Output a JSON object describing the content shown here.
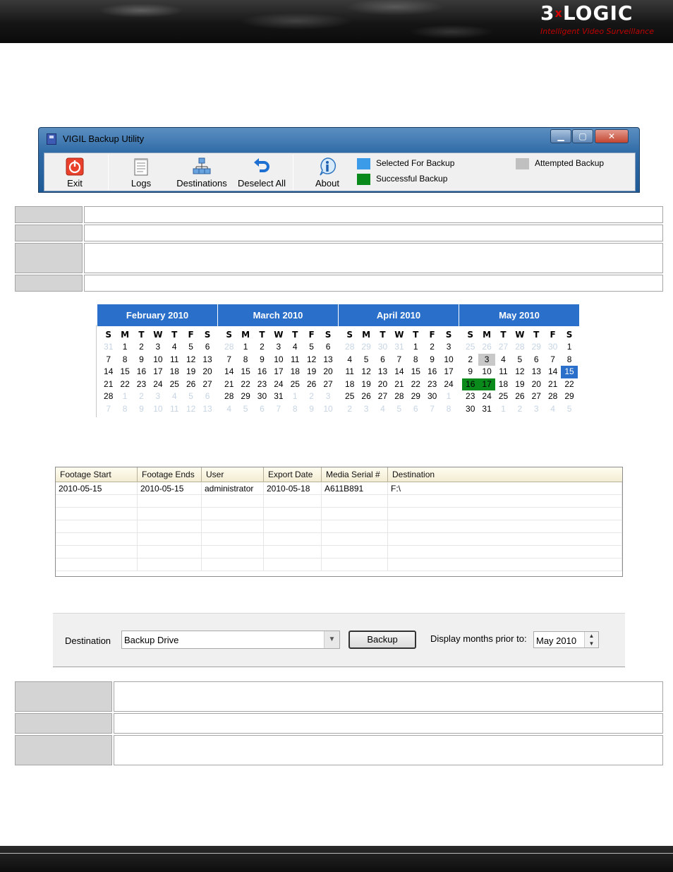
{
  "header": {
    "logo_text": "3xLOGIC",
    "logo_left": "3",
    "logo_x": "x",
    "logo_right": "LOGIC",
    "tagline": "Intelligent Video Surveillance"
  },
  "window": {
    "title": "VIGIL Backup Utility",
    "buttons": {
      "minimize": "▁",
      "maximize": "▢",
      "close": "✕"
    },
    "toolbar": {
      "exit": "Exit",
      "logs": "Logs",
      "destinations": "Destinations",
      "deselect_all": "Deselect All",
      "about": "About"
    },
    "legend": [
      {
        "label": "Selected For Backup",
        "color": "#3b9be8"
      },
      {
        "label": "Successful Backup",
        "color": "#0a8a1a"
      },
      {
        "label": "Attempted Backup",
        "color": "#c0c0c0"
      }
    ]
  },
  "calendar": {
    "day_headers": [
      "S",
      "M",
      "T",
      "W",
      "T",
      "F",
      "S"
    ],
    "months": [
      {
        "title": "February 2010",
        "days": [
          [
            "31",
            "o"
          ],
          [
            "1"
          ],
          [
            "2"
          ],
          [
            "3"
          ],
          [
            "4"
          ],
          [
            "5"
          ],
          [
            "6"
          ],
          [
            "7"
          ],
          [
            "8"
          ],
          [
            "9"
          ],
          [
            "10"
          ],
          [
            "11"
          ],
          [
            "12"
          ],
          [
            "13"
          ],
          [
            "14"
          ],
          [
            "15"
          ],
          [
            "16"
          ],
          [
            "17"
          ],
          [
            "18"
          ],
          [
            "19"
          ],
          [
            "20"
          ],
          [
            "21"
          ],
          [
            "22"
          ],
          [
            "23"
          ],
          [
            "24"
          ],
          [
            "25"
          ],
          [
            "26"
          ],
          [
            "27"
          ],
          [
            "28"
          ],
          [
            "1",
            "o"
          ],
          [
            "2",
            "o"
          ],
          [
            "3",
            "o"
          ],
          [
            "4",
            "o"
          ],
          [
            "5",
            "o"
          ],
          [
            "6",
            "o"
          ],
          [
            "7",
            "o"
          ],
          [
            "8",
            "o"
          ],
          [
            "9",
            "o"
          ],
          [
            "10",
            "o"
          ],
          [
            "11",
            "o"
          ],
          [
            "12",
            "o"
          ],
          [
            "13",
            "o"
          ]
        ]
      },
      {
        "title": "March 2010",
        "days": [
          [
            "28",
            "o"
          ],
          [
            "1"
          ],
          [
            "2"
          ],
          [
            "3"
          ],
          [
            "4"
          ],
          [
            "5"
          ],
          [
            "6"
          ],
          [
            "7"
          ],
          [
            "8"
          ],
          [
            "9"
          ],
          [
            "10"
          ],
          [
            "11"
          ],
          [
            "12"
          ],
          [
            "13"
          ],
          [
            "14"
          ],
          [
            "15"
          ],
          [
            "16"
          ],
          [
            "17"
          ],
          [
            "18"
          ],
          [
            "19"
          ],
          [
            "20"
          ],
          [
            "21"
          ],
          [
            "22"
          ],
          [
            "23"
          ],
          [
            "24"
          ],
          [
            "25"
          ],
          [
            "26"
          ],
          [
            "27"
          ],
          [
            "28"
          ],
          [
            "29"
          ],
          [
            "30"
          ],
          [
            "31"
          ],
          [
            "1",
            "o"
          ],
          [
            "2",
            "o"
          ],
          [
            "3",
            "o"
          ],
          [
            "4",
            "o"
          ],
          [
            "5",
            "o"
          ],
          [
            "6",
            "o"
          ],
          [
            "7",
            "o"
          ],
          [
            "8",
            "o"
          ],
          [
            "9",
            "o"
          ],
          [
            "10",
            "o"
          ]
        ]
      },
      {
        "title": "April 2010",
        "days": [
          [
            "28",
            "o"
          ],
          [
            "29",
            "o"
          ],
          [
            "30",
            "o"
          ],
          [
            "31",
            "o"
          ],
          [
            "1"
          ],
          [
            "2"
          ],
          [
            "3"
          ],
          [
            "4"
          ],
          [
            "5"
          ],
          [
            "6"
          ],
          [
            "7"
          ],
          [
            "8"
          ],
          [
            "9"
          ],
          [
            "10"
          ],
          [
            "11"
          ],
          [
            "12"
          ],
          [
            "13"
          ],
          [
            "14"
          ],
          [
            "15"
          ],
          [
            "16"
          ],
          [
            "17"
          ],
          [
            "18"
          ],
          [
            "19"
          ],
          [
            "20"
          ],
          [
            "21"
          ],
          [
            "22"
          ],
          [
            "23"
          ],
          [
            "24"
          ],
          [
            "25"
          ],
          [
            "26"
          ],
          [
            "27"
          ],
          [
            "28"
          ],
          [
            "29"
          ],
          [
            "30"
          ],
          [
            "1",
            "o"
          ],
          [
            "2",
            "o"
          ],
          [
            "3",
            "o"
          ],
          [
            "4",
            "o"
          ],
          [
            "5",
            "o"
          ],
          [
            "6",
            "o"
          ],
          [
            "7",
            "o"
          ],
          [
            "8",
            "o"
          ]
        ]
      },
      {
        "title": "May 2010",
        "days": [
          [
            "25",
            "o"
          ],
          [
            "26",
            "o"
          ],
          [
            "27",
            "o"
          ],
          [
            "28",
            "o"
          ],
          [
            "29",
            "o"
          ],
          [
            "30",
            "o"
          ],
          [
            "1"
          ],
          [
            "2"
          ],
          [
            "3",
            "att"
          ],
          [
            "4"
          ],
          [
            "5"
          ],
          [
            "6"
          ],
          [
            "7"
          ],
          [
            "8"
          ],
          [
            "9"
          ],
          [
            "10"
          ],
          [
            "11"
          ],
          [
            "12"
          ],
          [
            "13"
          ],
          [
            "14"
          ],
          [
            "15",
            "sel"
          ],
          [
            "16",
            "ok"
          ],
          [
            "17",
            "ok"
          ],
          [
            "18"
          ],
          [
            "19"
          ],
          [
            "20"
          ],
          [
            "21"
          ],
          [
            "22"
          ],
          [
            "23"
          ],
          [
            "24"
          ],
          [
            "25"
          ],
          [
            "26"
          ],
          [
            "27"
          ],
          [
            "28"
          ],
          [
            "29"
          ],
          [
            "30"
          ],
          [
            "31"
          ],
          [
            "1",
            "o"
          ],
          [
            "2",
            "o"
          ],
          [
            "3",
            "o"
          ],
          [
            "4",
            "o"
          ],
          [
            "5",
            "o"
          ]
        ]
      }
    ]
  },
  "log_table": {
    "columns": [
      "Footage Start",
      "Footage Ends",
      "User",
      "Export Date",
      "Media Serial #",
      "Destination"
    ],
    "rows": [
      [
        "2010-05-15",
        "2010-05-15",
        "administrator",
        "2010-05-18",
        "A611B891",
        "F:\\"
      ]
    ]
  },
  "bottom_panel": {
    "destination_label": "Destination",
    "destination_value": "Backup Drive",
    "backup_button": "Backup",
    "display_months_label": "Display months prior to:",
    "display_months_value": "May 2010"
  }
}
